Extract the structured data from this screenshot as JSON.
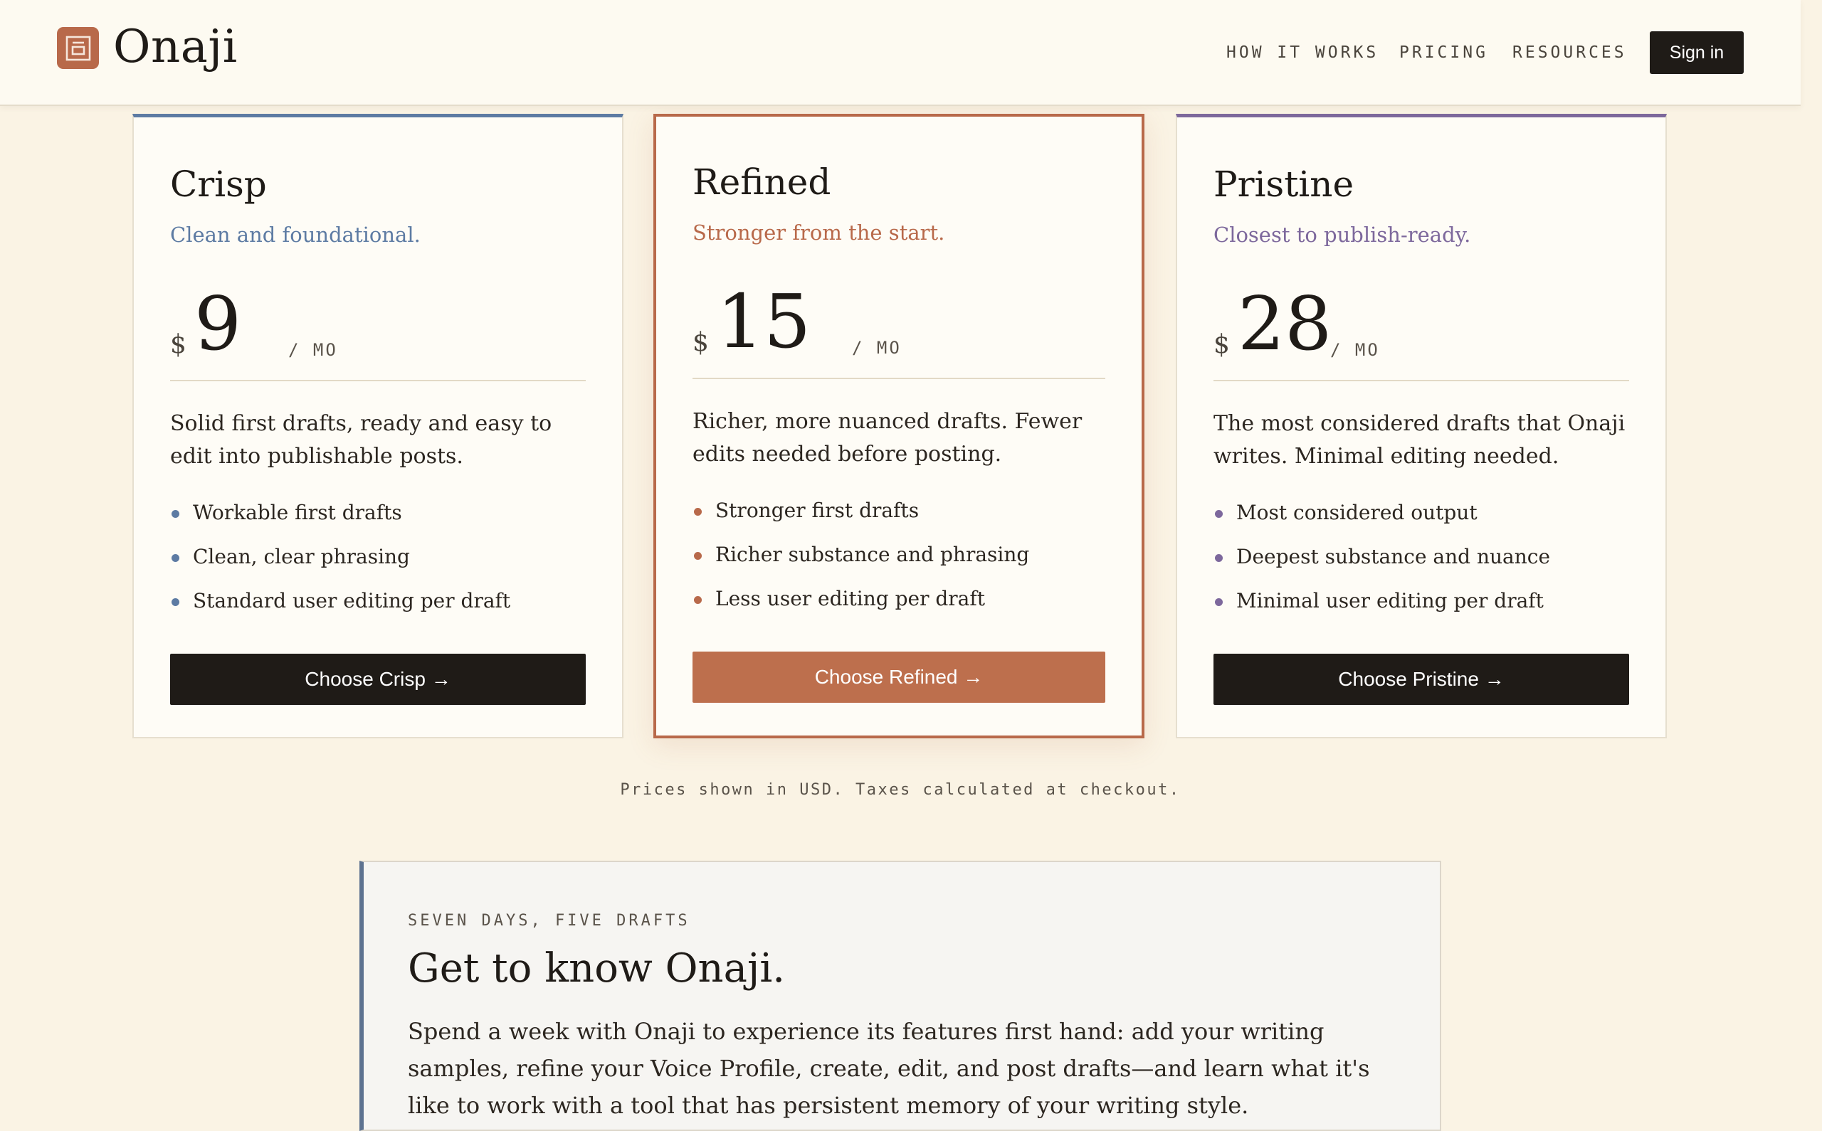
{
  "header": {
    "brand": "Onaji",
    "logo_icon": "onaji-logo-icon",
    "nav": [
      {
        "label": "HOW IT WORKS"
      },
      {
        "label": "PRICING"
      },
      {
        "label": "RESOURCES"
      }
    ],
    "signin_label": "Sign in"
  },
  "colors": {
    "brand": "#b8694a",
    "crisp": "#5d7ba3",
    "refined": "#b8694a",
    "pristine": "#7d689c",
    "dark": "#1f1b17"
  },
  "plans": [
    {
      "name": "Crisp",
      "tagline": "Clean and foundational.",
      "currency": "$",
      "price": "9",
      "period": "/ MO",
      "description": "Solid first drafts, ready and easy to edit into publishable posts.",
      "features": [
        "Workable first drafts",
        "Clean, clear phrasing",
        "Standard user editing per draft"
      ],
      "cta": "Choose Crisp →"
    },
    {
      "name": "Refined",
      "tagline": "Stronger from the start.",
      "currency": "$",
      "price": "15",
      "period": "/ MO",
      "description": "Richer, more nuanced drafts. Fewer edits needed before posting.",
      "features": [
        "Stronger first drafts",
        "Richer substance and phrasing",
        "Less user editing per draft"
      ],
      "cta": "Choose Refined →"
    },
    {
      "name": "Pristine",
      "tagline": "Closest to publish-ready.",
      "currency": "$",
      "price": "28",
      "period": "/ MO",
      "description": "The most considered drafts that Onaji writes. Minimal editing needed.",
      "features": [
        "Most considered output",
        "Deepest substance and nuance",
        "Minimal user editing per draft"
      ],
      "cta": "Choose Pristine →"
    }
  ],
  "pricing_note": "Prices shown in USD. Taxes calculated at checkout.",
  "trial": {
    "eyebrow": "SEVEN DAYS, FIVE DRAFTS",
    "title": "Get to know Onaji.",
    "body": "Spend a week with Onaji to experience its features first hand: add your writing samples, refine your Voice Profile, create, edit, and post drafts—and learn what it's like to work with a tool that has persistent memory of your writing style."
  }
}
